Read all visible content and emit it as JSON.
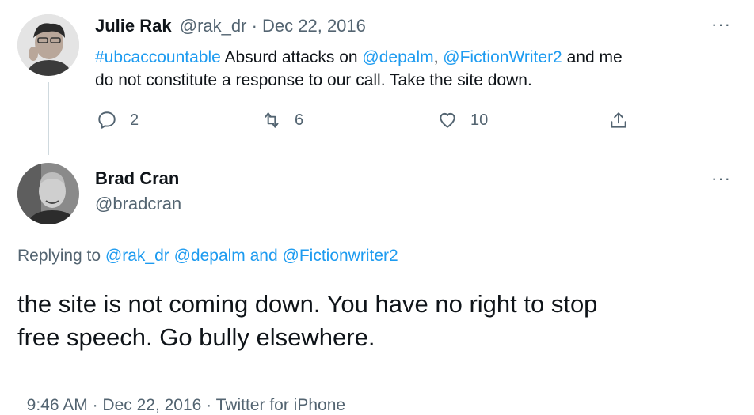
{
  "tweet1": {
    "name": "Julie Rak",
    "handle": "@rak_dr",
    "separator": "·",
    "date": "Dec 22, 2016",
    "more": "···",
    "text_hashtag": "#ubcaccountable",
    "text_part1": " Absurd attacks on ",
    "mention1": "@depalm",
    "comma": ", ",
    "mention2": "@FictionWriter2",
    "text_part2": " and me",
    "text_line2": "do not constitute a response to our call.  Take the site down.",
    "replies": "2",
    "retweets": "6",
    "likes": "10"
  },
  "tweet2": {
    "name": "Brad Cran",
    "handle": "@bradcran",
    "more": "···",
    "replying_label": "Replying to ",
    "replying_mention1": "@rak_dr",
    "replying_mention2": "@depalm",
    "replying_and": " and ",
    "replying_mention3": "@Fictionwriter2",
    "text_line1": "the site is not coming down. You have no right to stop",
    "text_line2": "free speech. Go bully elsewhere.",
    "time": "9:46 AM",
    "sep": " · ",
    "date": "Dec 22, 2016",
    "source": "Twitter for iPhone"
  },
  "icons": [
    "reply-icon",
    "retweet-icon",
    "like-icon",
    "share-icon"
  ]
}
